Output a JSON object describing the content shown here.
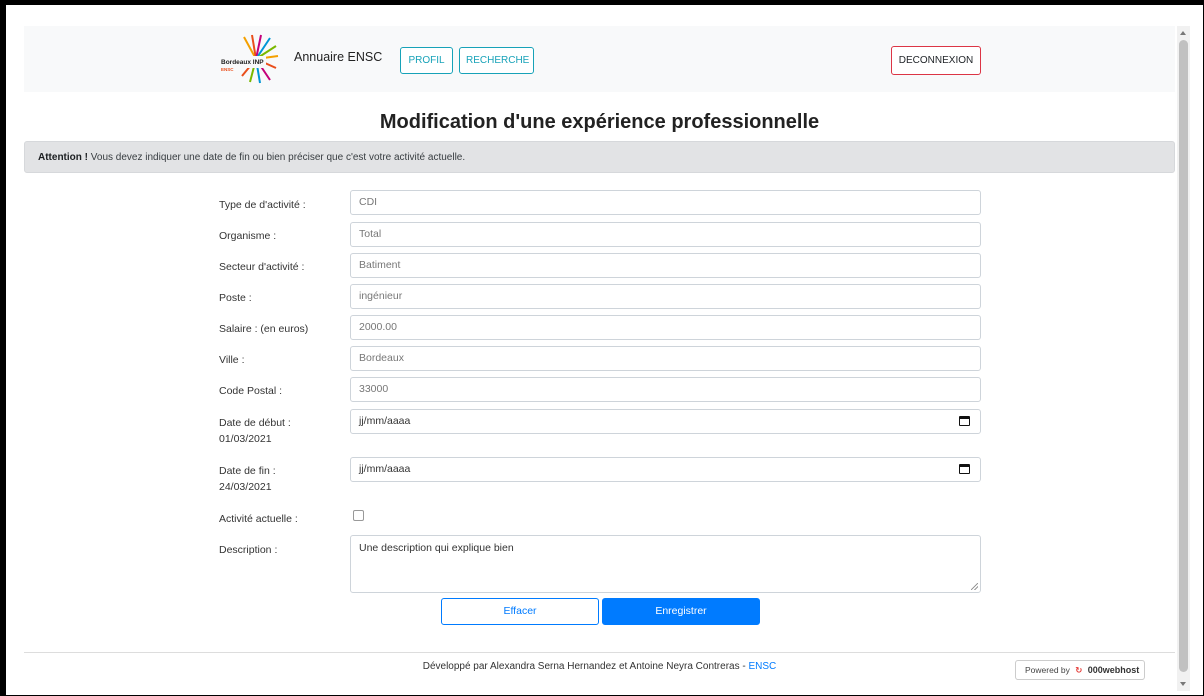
{
  "nav": {
    "brand_logo_text": "Bordeaux INP ENSC",
    "brand": "Annuaire ENSC",
    "profil": "PROFIL",
    "recherche": "RECHERCHE",
    "deconnexion": "DECONNEXION"
  },
  "page": {
    "title": "Modification d'une expérience professionnelle"
  },
  "alert": {
    "strong": "Attention !",
    "text": " Vous devez indiquer une date de fin ou bien préciser que c'est votre activité actuelle."
  },
  "form": {
    "type_label": "Type de d'activité :",
    "type_value": "CDI",
    "organisme_label": "Organisme :",
    "organisme_value": "Total",
    "secteur_label": "Secteur d'activité :",
    "secteur_value": "Batiment",
    "poste_label": "Poste :",
    "poste_value": "ingénieur",
    "salaire_label": "Salaire : (en euros)",
    "salaire_value": "2000.00",
    "ville_label": "Ville :",
    "ville_value": "Bordeaux",
    "cp_label": "Code Postal :",
    "cp_value": "33000",
    "debut_label": "Date de début :",
    "debut_current": "01/03/2021",
    "debut_placeholder": "jj/mm/aaaa",
    "fin_label": "Date de fin :",
    "fin_current": "24/03/2021",
    "fin_placeholder": "jj/mm/aaaa",
    "actuelle_label": "Activité actuelle :",
    "actuelle_checked": false,
    "description_label": "Description :",
    "description_value": "Une description  qui explique bien"
  },
  "buttons": {
    "effacer": "Effacer",
    "enregistrer": "Enregistrer"
  },
  "footer": {
    "text": "Développé par Alexandra Serna Hernandez et Antoine Neyra Contreras - ",
    "link": "ENSC",
    "powered_prefix": "Powered by",
    "powered_brand": "000webhost"
  },
  "colors": {
    "info": "#17a2b8",
    "danger": "#dc3545",
    "primary": "#007bff",
    "alert_bg": "#e2e3e5"
  }
}
